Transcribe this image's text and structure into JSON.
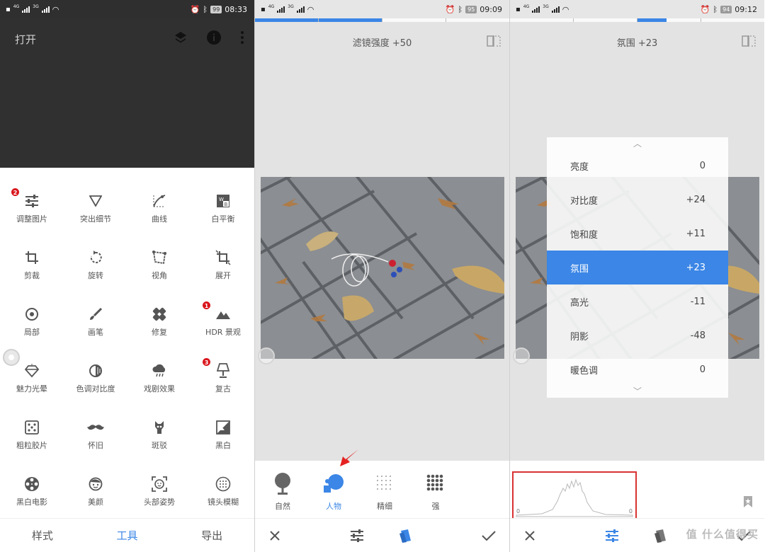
{
  "screen1": {
    "status": {
      "net1": "4G",
      "net2": "3G",
      "battery": "99",
      "time": "08:33"
    },
    "header": {
      "title": "打开",
      "icons": [
        "layers-icon",
        "info-icon",
        "more-vert-icon"
      ]
    },
    "tools": [
      {
        "label": "调整图片",
        "icon": "tune-icon",
        "badge": "2"
      },
      {
        "label": "突出细节",
        "icon": "triangle-down-icon"
      },
      {
        "label": "曲线",
        "icon": "curves-icon"
      },
      {
        "label": "白平衡",
        "icon": "white-balance-icon"
      },
      {
        "label": "剪裁",
        "icon": "crop-icon"
      },
      {
        "label": "旋转",
        "icon": "rotate-icon"
      },
      {
        "label": "视角",
        "icon": "perspective-icon"
      },
      {
        "label": "展开",
        "icon": "expand-icon"
      },
      {
        "label": "局部",
        "icon": "selective-icon"
      },
      {
        "label": "画笔",
        "icon": "brush-icon"
      },
      {
        "label": "修复",
        "icon": "healing-icon"
      },
      {
        "label": "HDR 景观",
        "icon": "mountain-icon",
        "badge": "1"
      },
      {
        "label": "魅力光晕",
        "icon": "diamond-icon"
      },
      {
        "label": "色调对比度",
        "icon": "tonal-contrast-icon"
      },
      {
        "label": "戏剧效果",
        "icon": "cloud-icon"
      },
      {
        "label": "复古",
        "icon": "lamp-icon",
        "badge": "3"
      },
      {
        "label": "粗粒胶片",
        "icon": "dice-icon"
      },
      {
        "label": "怀旧",
        "icon": "mustache-icon"
      },
      {
        "label": "斑驳",
        "icon": "grunge-icon"
      },
      {
        "label": "黑白",
        "icon": "black-white-icon"
      },
      {
        "label": "黑白电影",
        "icon": "film-reel-icon"
      },
      {
        "label": "美颜",
        "icon": "face-icon"
      },
      {
        "label": "头部姿势",
        "icon": "head-pose-icon"
      },
      {
        "label": "镜头模糊",
        "icon": "lens-blur-icon"
      }
    ],
    "tabs": [
      "样式",
      "工具",
      "导出"
    ],
    "active_tab": "工具"
  },
  "screen2": {
    "status": {
      "net1": "4G",
      "net2": "3G",
      "battery": "95",
      "time": "09:09"
    },
    "title": "滤镜强度 +50",
    "progress_fraction": 0.5,
    "styles": [
      {
        "label": "自然",
        "icon": "natural-style-icon"
      },
      {
        "label": "人物",
        "icon": "portrait-style-icon",
        "active": true
      },
      {
        "label": "精细",
        "icon": "fine-dots-icon"
      },
      {
        "label": "强",
        "icon": "strong-dots-icon"
      }
    ],
    "bottom_icons": [
      "close-icon",
      "tune-icon",
      "styles-icon",
      "check-icon"
    ]
  },
  "screen3": {
    "status": {
      "net1": "4G",
      "net2": "3G",
      "battery": "94",
      "time": "09:12"
    },
    "title": "氛围 +23",
    "progress_fraction": 0.615,
    "adjustments": [
      {
        "label": "亮度",
        "value": "0"
      },
      {
        "label": "对比度",
        "value": "+24"
      },
      {
        "label": "饱和度",
        "value": "+11"
      },
      {
        "label": "氛围",
        "value": "+23",
        "active": true
      },
      {
        "label": "高光",
        "value": "-11"
      },
      {
        "label": "阴影",
        "value": "-48"
      },
      {
        "label": "暖色调",
        "value": "0"
      }
    ],
    "histogram_labels": [
      "0",
      "0"
    ],
    "bottom_icons": [
      "close-icon",
      "tune-icon",
      "styles-icon",
      "check-icon"
    ],
    "watermark": "值 什么值得买"
  },
  "colors": {
    "accent": "#3b86e6",
    "badge": "#d9161c",
    "highlight_box": "#d93232"
  }
}
